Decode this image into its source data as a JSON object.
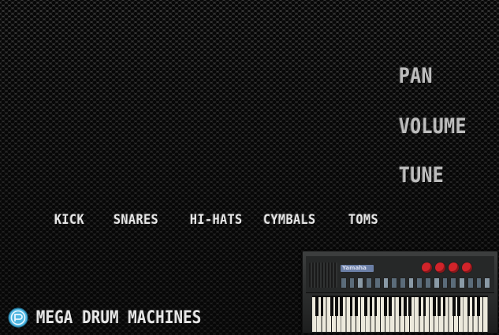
{
  "controls": {
    "pan": "PAN",
    "volume": "VOLUME",
    "tune": "TUNE"
  },
  "categories": [
    "KICK",
    "SNARES",
    "HI-HATS",
    "CYMBALS",
    "TOMS"
  ],
  "brand": {
    "name": "MEGA DRUM MACHINES",
    "icon": "app-logo-icon"
  },
  "keyboard_image": {
    "label": "Yamaha"
  },
  "colors": {
    "text_light": "#e6e6e6",
    "text_muted": "#bdbdbd",
    "icon_blue": "#4fb6e0",
    "keyboard_button_red": "#d1242a"
  }
}
